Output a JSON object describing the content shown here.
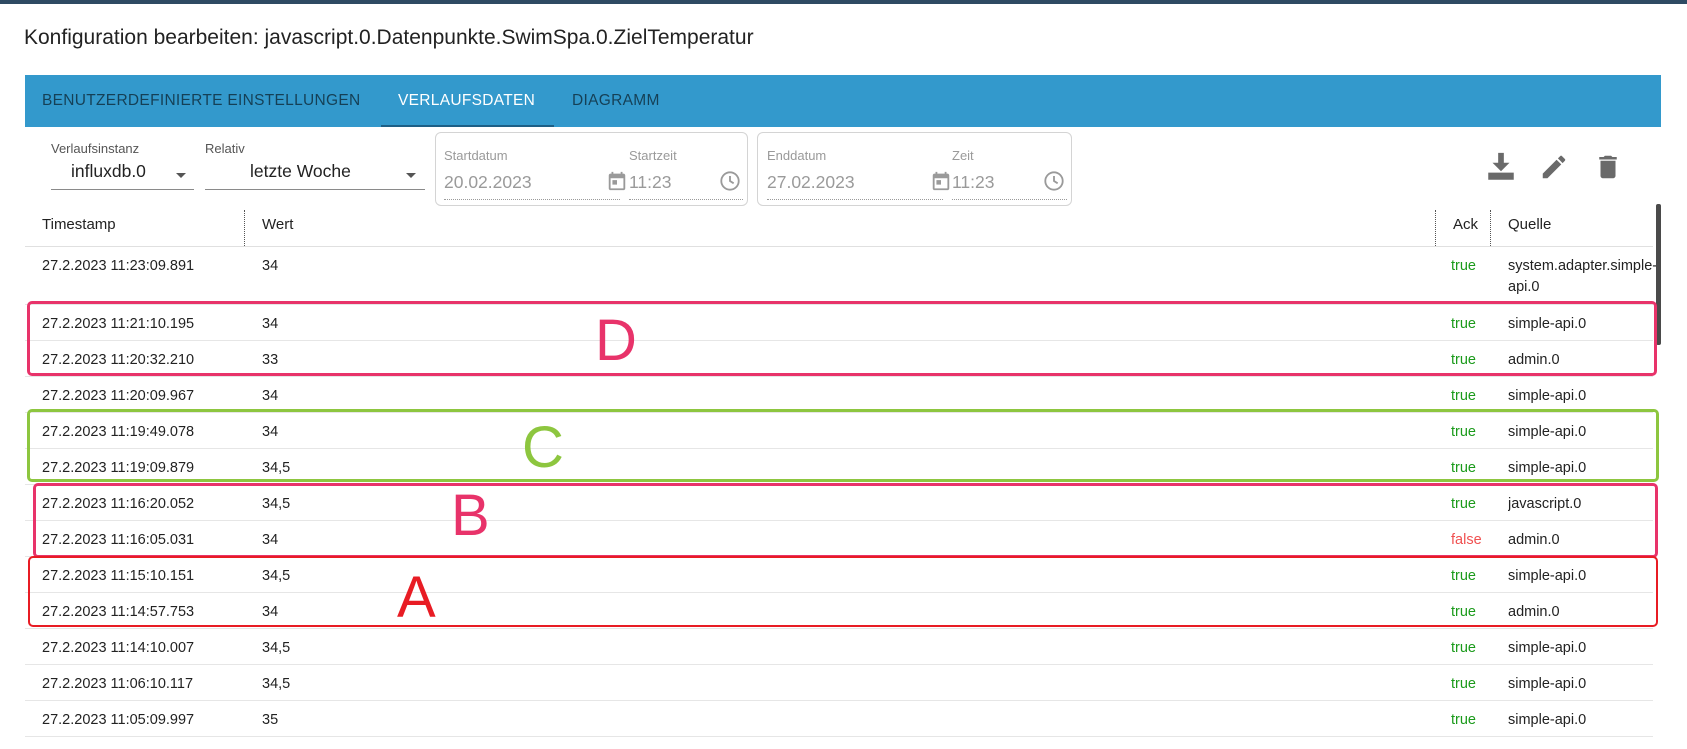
{
  "title": "Konfiguration bearbeiten: javascript.0.Datenpunkte.SwimSpa.0.ZielTemperatur",
  "tabs": [
    {
      "label": "BENUTZERDEFINIERTE EINSTELLUNGEN",
      "active": false
    },
    {
      "label": "VERLAUFSDATEN",
      "active": true
    },
    {
      "label": "DIAGRAMM",
      "active": false
    }
  ],
  "filters": {
    "instance": {
      "label": "Verlaufsinstanz",
      "value": "influxdb.0"
    },
    "relative": {
      "label": "Relativ",
      "value": "letzte Woche"
    },
    "start_date": {
      "label": "Startdatum",
      "value": "20.02.2023"
    },
    "start_time": {
      "label": "Startzeit",
      "value": "11:23"
    },
    "end_date": {
      "label": "Enddatum",
      "value": "27.02.2023"
    },
    "end_time": {
      "label": "Zeit",
      "value": "11:23"
    }
  },
  "toolbar": {
    "download_icon": "download-icon",
    "edit_icon": "edit-icon",
    "delete_icon": "delete-icon"
  },
  "table": {
    "columns": [
      "Timestamp",
      "Wert",
      "Ack",
      "Quelle"
    ],
    "rows": [
      {
        "ts": "27.2.2023 11:23:09.891",
        "val": "34",
        "ack": "true",
        "src": "system.adapter.simple-api.0"
      },
      {
        "ts": "27.2.2023 11:21:10.195",
        "val": "34",
        "ack": "true",
        "src": "simple-api.0"
      },
      {
        "ts": "27.2.2023 11:20:32.210",
        "val": "33",
        "ack": "true",
        "src": "admin.0"
      },
      {
        "ts": "27.2.2023 11:20:09.967",
        "val": "34",
        "ack": "true",
        "src": "simple-api.0"
      },
      {
        "ts": "27.2.2023 11:19:49.078",
        "val": "34",
        "ack": "true",
        "src": "simple-api.0"
      },
      {
        "ts": "27.2.2023 11:19:09.879",
        "val": "34,5",
        "ack": "true",
        "src": "simple-api.0"
      },
      {
        "ts": "27.2.2023 11:16:20.052",
        "val": "34,5",
        "ack": "true",
        "src": "javascript.0"
      },
      {
        "ts": "27.2.2023 11:16:05.031",
        "val": "34",
        "ack": "false",
        "src": "admin.0"
      },
      {
        "ts": "27.2.2023 11:15:10.151",
        "val": "34,5",
        "ack": "true",
        "src": "simple-api.0"
      },
      {
        "ts": "27.2.2023 11:14:57.753",
        "val": "34",
        "ack": "true",
        "src": "admin.0"
      },
      {
        "ts": "27.2.2023 11:14:10.007",
        "val": "34,5",
        "ack": "true",
        "src": "simple-api.0"
      },
      {
        "ts": "27.2.2023 11:06:10.117",
        "val": "34,5",
        "ack": "true",
        "src": "simple-api.0"
      },
      {
        "ts": "27.2.2023 11:05:09.997",
        "val": "35",
        "ack": "true",
        "src": "simple-api.0"
      }
    ]
  },
  "annotations": [
    {
      "letter": "D",
      "color": "#e8336a"
    },
    {
      "letter": "C",
      "color": "#8dc63f"
    },
    {
      "letter": "B",
      "color": "#e8336a"
    },
    {
      "letter": "A",
      "color": "#e81c24"
    }
  ],
  "colors": {
    "tabbar": "#3399cc",
    "ack_true": "#1a9a1a",
    "ack_false": "#f05050"
  }
}
